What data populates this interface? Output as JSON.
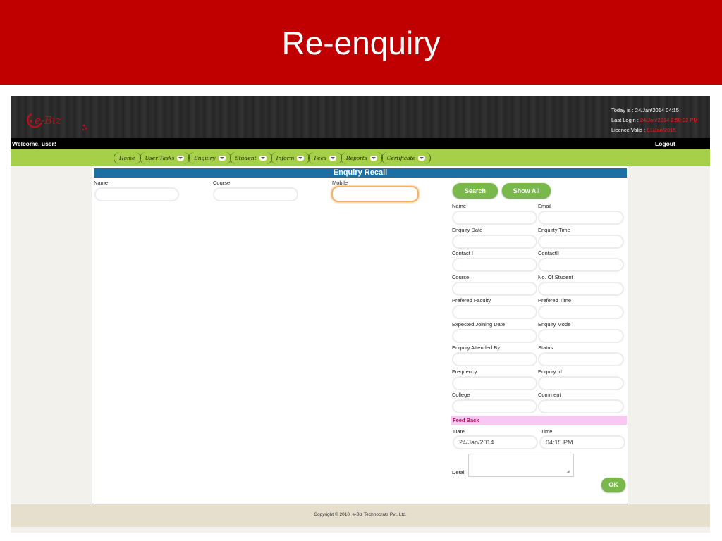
{
  "slide": {
    "title": "Re-enquiry"
  },
  "header": {
    "logo_text": "e-Biz",
    "today_label": "Today is :",
    "today_value": "24/Jan/2014 04:15",
    "last_login_label": "Last Login :",
    "last_login_value": "24/Jan/2014 2:50:02 PM",
    "licence_label": "Licence Valid :",
    "licence_value": "01/Jan/2015",
    "accent_color": "#e8231e"
  },
  "welcome": {
    "text": "Welcome,  user!",
    "logout_label": "Logout"
  },
  "nav": {
    "items": [
      {
        "label": "Home",
        "dropdown": false
      },
      {
        "label": "User Tasks",
        "dropdown": true
      },
      {
        "label": "Enquiry",
        "dropdown": true
      },
      {
        "label": "Student",
        "dropdown": true
      },
      {
        "label": "Inform",
        "dropdown": true
      },
      {
        "label": "Fees",
        "dropdown": true
      },
      {
        "label": "Reports",
        "dropdown": true
      },
      {
        "label": "Certificate",
        "dropdown": true
      }
    ]
  },
  "panel": {
    "title": "Enquiry Recall",
    "search": {
      "name_label": "Name",
      "course_label": "Course",
      "mobile_label": "Mobile",
      "name_value": "",
      "course_value": "",
      "mobile_value": ""
    },
    "buttons": {
      "search": "Search",
      "show_all": "Show All",
      "ok": "OK"
    },
    "details": {
      "fields": [
        {
          "left": "Name",
          "right": "Email"
        },
        {
          "left": "Enquiry Date",
          "right": "Enquirty Time"
        },
        {
          "left": "Contact I",
          "right": "ContactII"
        },
        {
          "left": "Course",
          "right": "No. Of Student"
        },
        {
          "left": "Prefered Faculty",
          "right": "Prefered Time"
        },
        {
          "left": "Expected Joining Date",
          "right": "Enquiry Mode"
        },
        {
          "left": "Enquiry Attended By",
          "right": "Status"
        },
        {
          "left": "Frequency",
          "right": "Enquiry Id"
        },
        {
          "left": "College",
          "right": "Comment"
        }
      ]
    },
    "feedback": {
      "heading": "Feed Back",
      "date_label": "Date",
      "time_label": "Time",
      "date_value": "24/Jan/2014",
      "time_value": "04:15 PM",
      "detail_label": "Detail"
    }
  },
  "footer": {
    "copyright": "Copyright © 2010, e-Biz Technocrats Pvt. Ltd."
  },
  "colors": {
    "title_bar": "#c00000",
    "nav_bar": "#a6cf4a",
    "panel_header": "#1b6fa3",
    "button": "#79b94b",
    "feedback_bg": "#f8c8f2"
  }
}
